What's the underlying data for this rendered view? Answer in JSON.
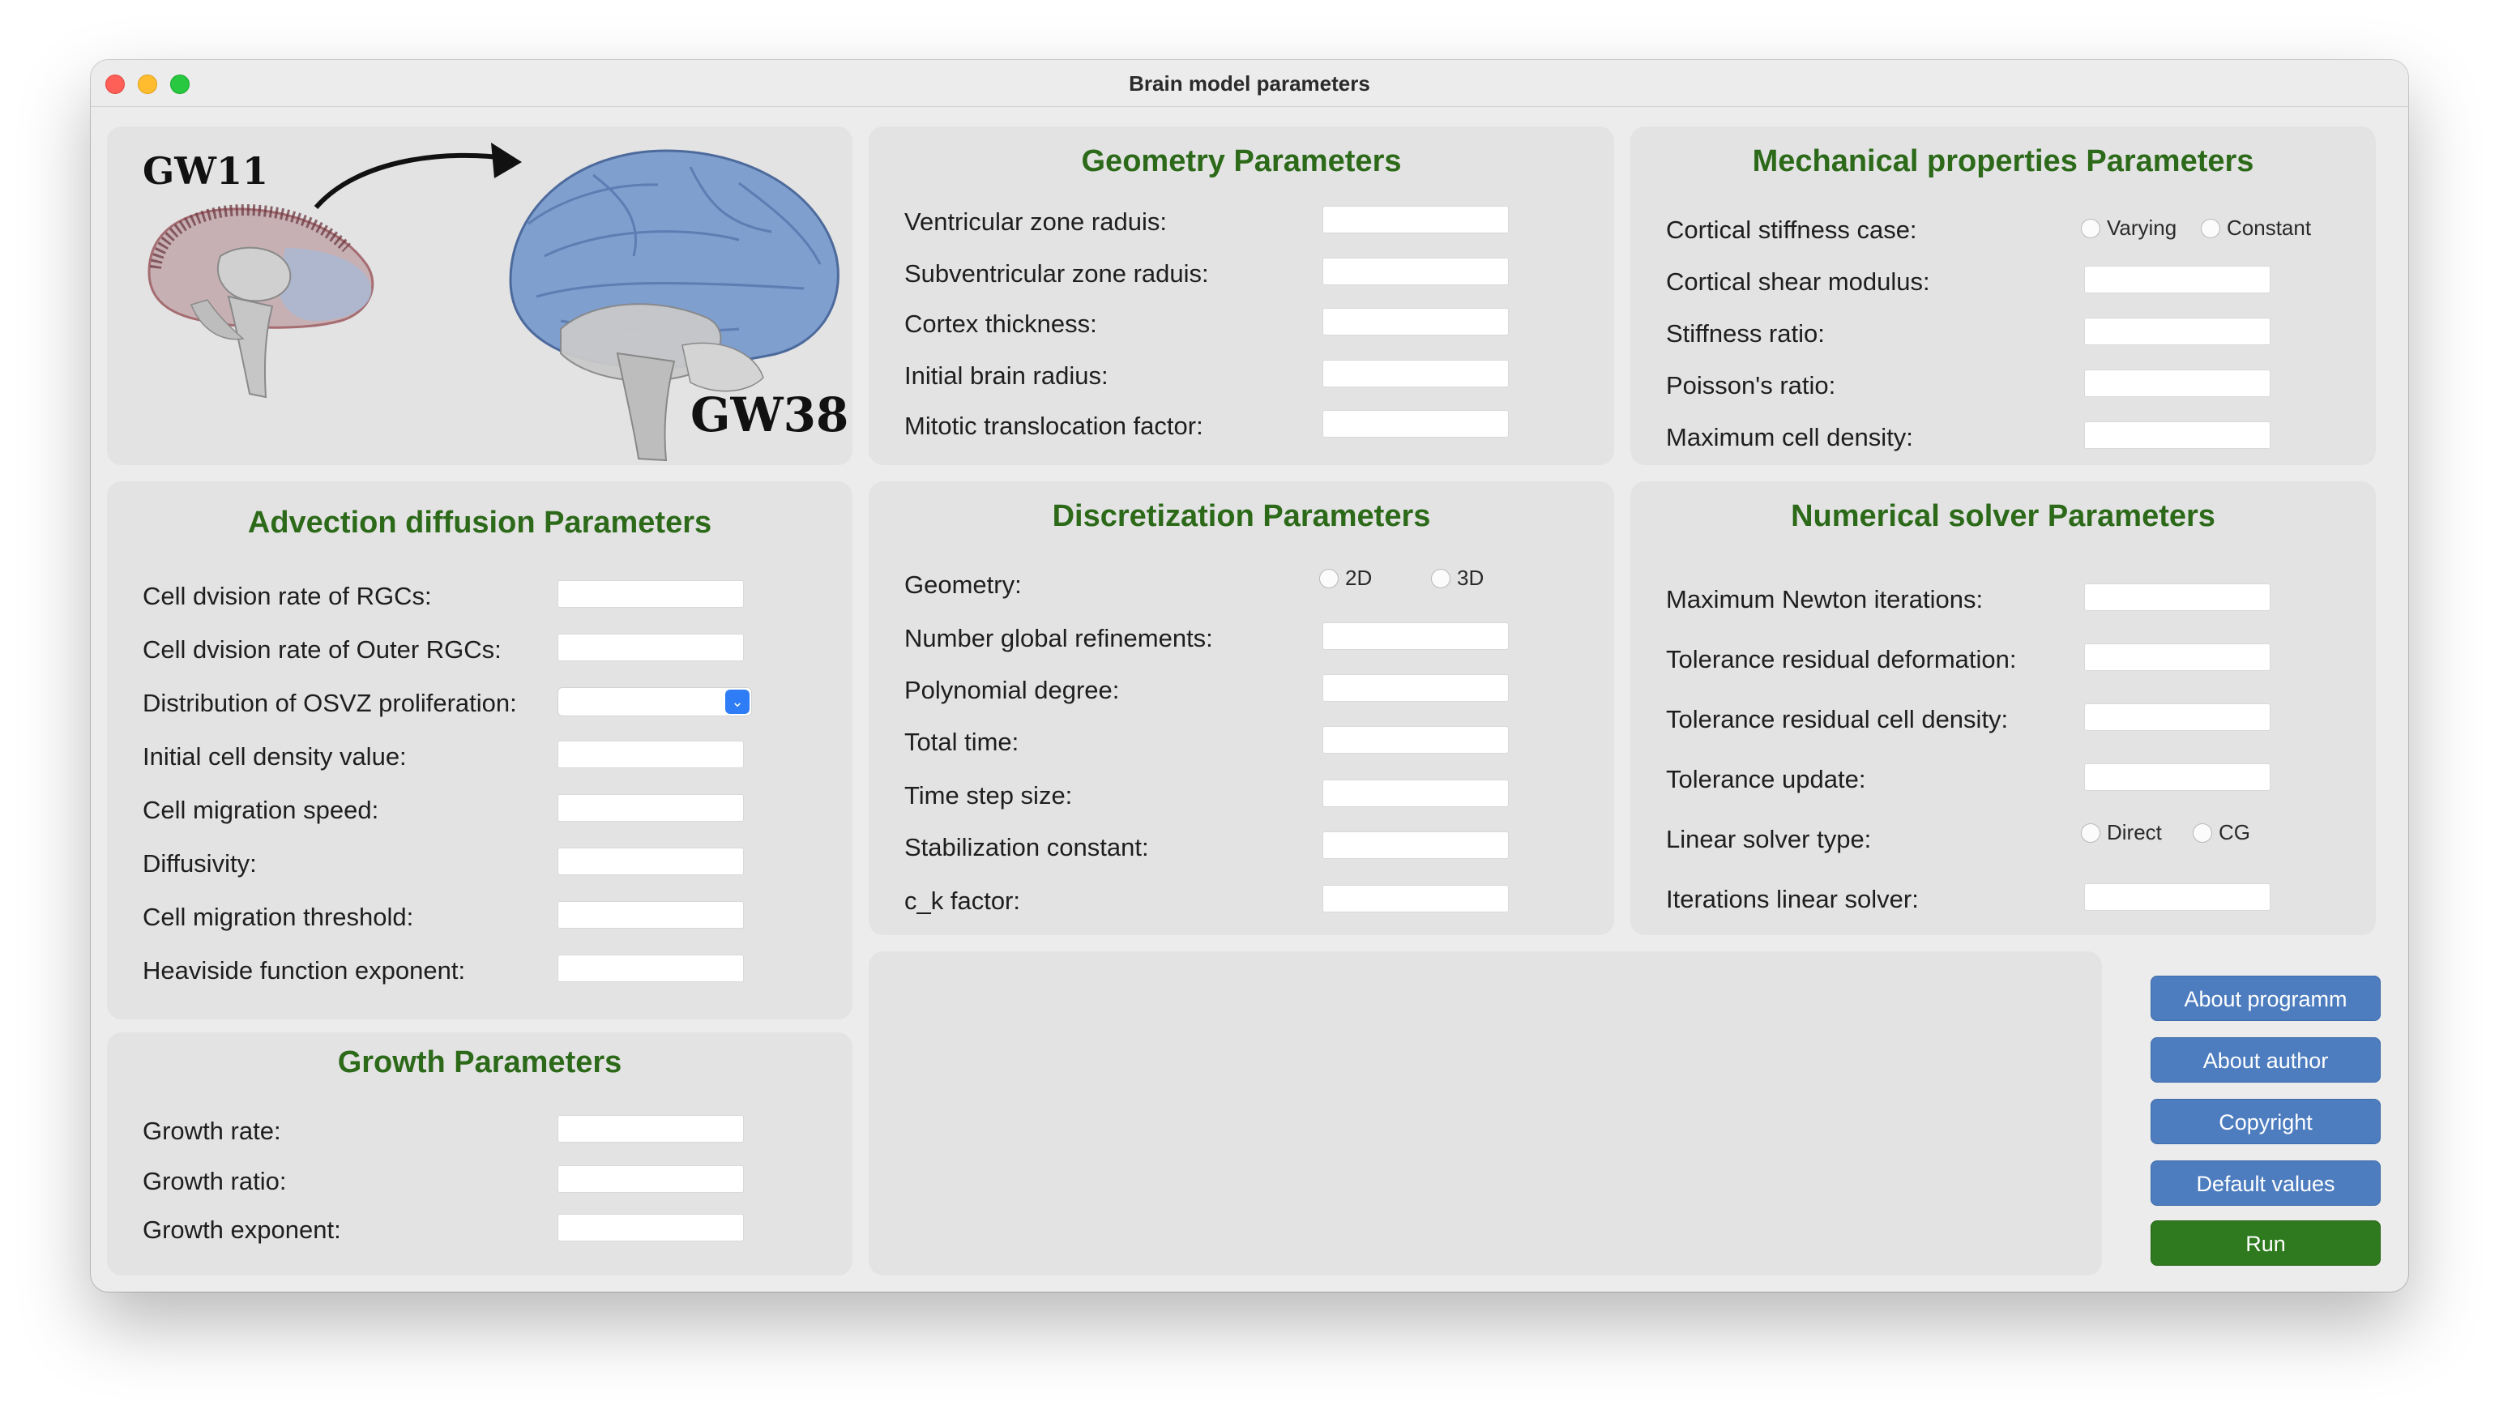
{
  "window": {
    "title": "Brain model parameters"
  },
  "image": {
    "early_label": "GW11",
    "late_label": "GW38",
    "colors": {
      "brain_blue": "#7f9fcf",
      "brain_grey": "#c9c9c9",
      "cortex_red": "#a56d72"
    }
  },
  "geometry": {
    "title": "Geometry Parameters",
    "fields": [
      "Ventricular zone raduis:",
      "Subventricular zone raduis:",
      "Cortex thickness:",
      "Initial brain radius:",
      "Mitotic translocation factor:"
    ]
  },
  "mechanical": {
    "title": "Mechanical properties Parameters",
    "stiffness_label": "Cortical stiffness case:",
    "stiffness_options": [
      "Varying",
      "Constant"
    ],
    "fields": [
      "Cortical shear modulus:",
      "Stiffness ratio:",
      "Poisson's ratio:",
      "Maximum cell density:"
    ]
  },
  "advection": {
    "title": "Advection diffusion Parameters",
    "rgc_label": "Cell dvision rate of RGCs:",
    "outer_rgc_label": "Cell dvision rate of Outer RGCs:",
    "osvz_label": "Distribution of OSVZ proliferation:",
    "osvz_value": "",
    "fields": [
      "Initial cell density value:",
      "Cell migration speed:",
      "Diffusivity:",
      "Cell migration threshold:",
      "Heaviside function exponent:"
    ]
  },
  "discretization": {
    "title": "Discretization Parameters",
    "geometry_label": "Geometry:",
    "geometry_options": [
      "2D",
      "3D"
    ],
    "fields": [
      "Number global refinements:",
      "Polynomial degree:",
      "Total time:",
      "Time step size:",
      "Stabilization constant:",
      "c_k factor:"
    ]
  },
  "numerical": {
    "title": "Numerical solver Parameters",
    "fields_top": [
      "Maximum Newton iterations:",
      "Tolerance residual deformation:",
      "Tolerance residual cell density:",
      "Tolerance update:"
    ],
    "solver_label": "Linear solver type:",
    "solver_options": [
      "Direct",
      "CG"
    ],
    "iterations_label": "Iterations linear solver:"
  },
  "growth": {
    "title": "Growth Parameters",
    "fields": [
      "Growth rate:",
      "Growth ratio:",
      "Growth exponent:"
    ]
  },
  "buttons": {
    "about_program": "About programm",
    "about_author": "About author",
    "copyright": "Copyright",
    "default_values": "Default values",
    "run": "Run"
  },
  "colors": {
    "title_green": "#2c6a1a",
    "button_blue": "#4d7dbf",
    "run_green": "#2f7a1f",
    "panel_bg": "#e3e3e3",
    "window_bg": "#ececec"
  }
}
